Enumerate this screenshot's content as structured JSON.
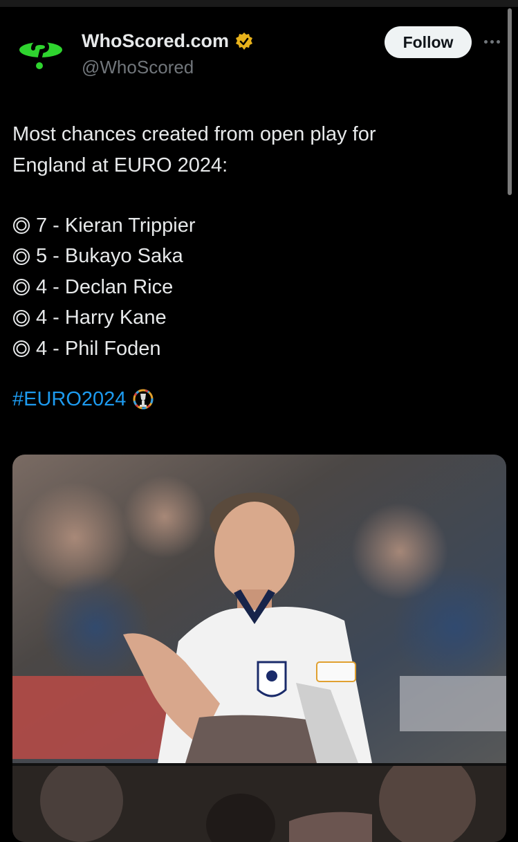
{
  "account": {
    "display_name": "WhoScored.com",
    "handle": "@WhoScored",
    "avatar_icon": "whoscored-logo-icon",
    "verified_icon": "verified-badge-icon",
    "follow_label": "Follow"
  },
  "tweet": {
    "intro_line1": "Most chances created from open play for",
    "intro_line2": "England at EURO 2024:",
    "items": [
      {
        "text": "7 - Kieran Trippier"
      },
      {
        "text": "5 - Bukayo Saka"
      },
      {
        "text": "4 - Declan Rice"
      },
      {
        "text": "4 - Harry Kane"
      },
      {
        "text": "4 - Phil Foden"
      }
    ],
    "bullet_icon": "double-circle-icon",
    "hashtag": "#EURO2024",
    "hashtag_emoji_icon": "euro-trophy-icon"
  },
  "media": {
    "photo1_icon": "player-clapping-photo",
    "photo2_icon": "player-photo"
  },
  "colors": {
    "background": "#000000",
    "text": "#e7e9ea",
    "secondary": "#71767b",
    "link": "#1d9bf0",
    "brand_green": "#2fd42f",
    "verified_gold": "#e8b21b"
  }
}
